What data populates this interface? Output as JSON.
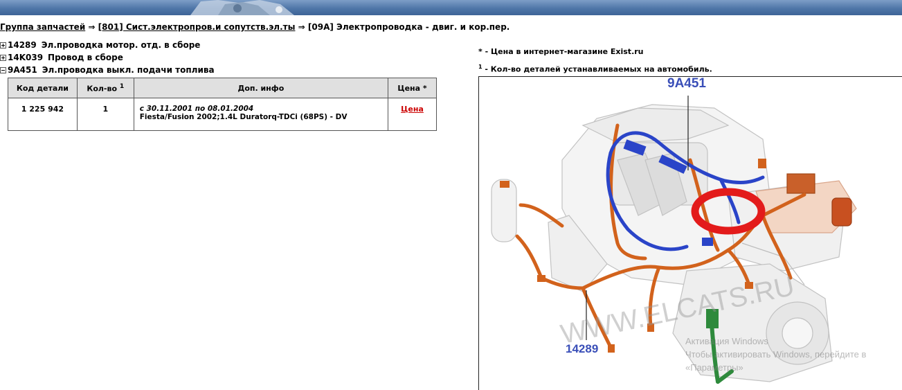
{
  "breadcrumb": {
    "group_link": "Группа запчастей",
    "arrow1": "⇒",
    "section_link": "[801] Сист.электропров.и сопутств.эл.ты",
    "arrow2": "⇒",
    "current": "[09A] Электропроводка - двиг. и кор.пер."
  },
  "tree": [
    {
      "code": "14289",
      "label": "Эл.проводка мотор. отд. в сборе",
      "state": "collapsed"
    },
    {
      "code": "14K039",
      "label": "Провод в сборе",
      "state": "collapsed"
    },
    {
      "code": "9A451",
      "label": "Эл.проводка выкл. подачи топлива",
      "state": "expanded"
    }
  ],
  "table": {
    "headers": {
      "code": "Код детали",
      "qty": "Кол-во",
      "qty_sup": "1",
      "info": "Доп. инфо",
      "price": "Цена *"
    },
    "rows": [
      {
        "code": "1 225 942",
        "qty": "1",
        "dates": "с 30.11.2001 по 08.01.2004",
        "model": "Fiesta/Fusion 2002;1.4L Duratorq-TDCi (68PS) - DV",
        "price_link": "Цена"
      }
    ]
  },
  "notes": {
    "price_note": "* - Цена в интернет-магазине Exist.ru",
    "qty_sup": "1",
    "qty_note": " - Кол-во деталей устанавливаемых на автомобиль."
  },
  "diagram": {
    "callout_top": "9A451",
    "callout_bottom": "14289",
    "watermark": "WWW.ELCATS.RU",
    "activation_line1": "Активация Windows",
    "activation_line2": "Чтобы активировать Windows, перейдите в",
    "activation_line3": "«Параметры»",
    "colors": {
      "harness_orange": "#d2621c",
      "harness_blue": "#2a44c8",
      "harness_green": "#2e8a3c",
      "highlight_red": "#e31b1b",
      "callout_blue": "#3a4fb8"
    }
  }
}
